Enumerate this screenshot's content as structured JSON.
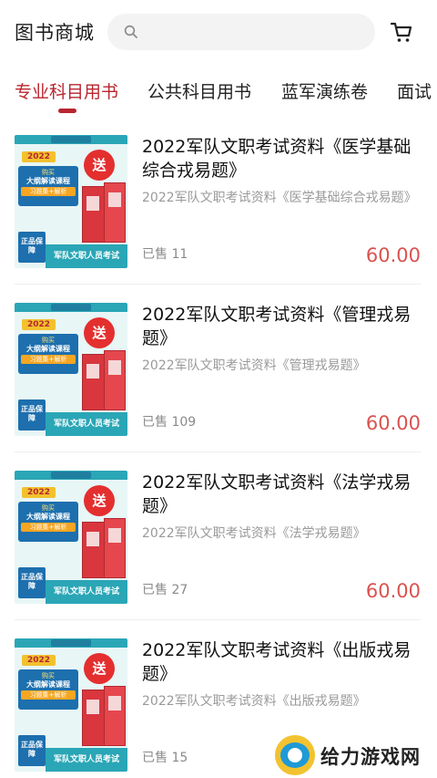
{
  "header": {
    "title": "图书商城",
    "search_placeholder": ""
  },
  "tabs": [
    {
      "label": "专业科目用书",
      "active": true
    },
    {
      "label": "公共科目用书",
      "active": false
    },
    {
      "label": "蓝军演练卷",
      "active": false
    },
    {
      "label": "面试",
      "active": false
    }
  ],
  "cover": {
    "year": "2022",
    "promo_line1": "购买",
    "promo_line2": "大纲解读课程",
    "promo_line3": "习题集+解析",
    "gift": "送",
    "stamp": "正品保障",
    "band": "军队文职人员考试"
  },
  "products": [
    {
      "title": "2022军队文职考试资料《医学基础综合戎易题》",
      "subtitle": "2022军队文职考试资料《医学基础综合戎易题》",
      "sold": "已售 11",
      "price": "60.00"
    },
    {
      "title": "2022军队文职考试资料《管理戎易题》",
      "subtitle": "2022军队文职考试资料《管理戎易题》",
      "sold": "已售 109",
      "price": "60.00"
    },
    {
      "title": "2022军队文职考试资料《法学戎易题》",
      "subtitle": "2022军队文职考试资料《法学戎易题》",
      "sold": "已售 27",
      "price": "60.00"
    },
    {
      "title": " 2022军队文职考试资料《出版戎易题》",
      "subtitle": " 2022军队文职考试资料《出版戎易题》",
      "sold": "已售 15",
      "price": ""
    }
  ],
  "watermark": {
    "text": "给力游戏网"
  },
  "colors": {
    "accent": "#b8262e",
    "price": "#d9534f"
  }
}
